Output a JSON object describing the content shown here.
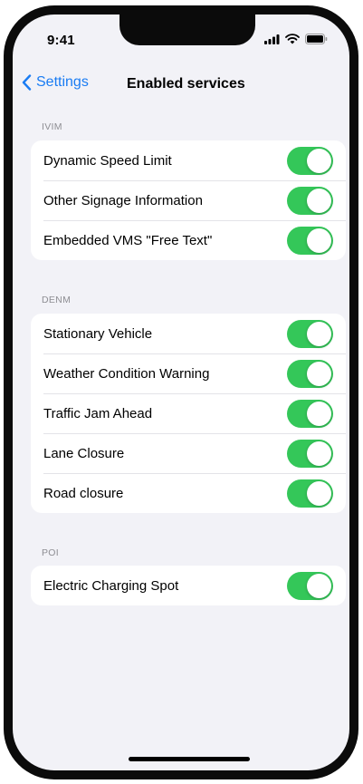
{
  "status_bar": {
    "time": "9:41"
  },
  "nav": {
    "back_label": "Settings",
    "title": "Enabled services"
  },
  "colors": {
    "accent": "#1a7cf3",
    "toggle_on": "#34c759",
    "background": "#f2f2f7"
  },
  "sections": [
    {
      "header": "IVIM",
      "items": [
        {
          "label": "Dynamic Speed Limit",
          "enabled": true
        },
        {
          "label": "Other Signage Information",
          "enabled": true
        },
        {
          "label": "Embedded VMS \"Free Text\"",
          "enabled": true
        }
      ]
    },
    {
      "header": "DENM",
      "items": [
        {
          "label": "Stationary Vehicle",
          "enabled": true
        },
        {
          "label": "Weather Condition Warning",
          "enabled": true
        },
        {
          "label": "Traffic Jam Ahead",
          "enabled": true
        },
        {
          "label": "Lane Closure",
          "enabled": true
        },
        {
          "label": "Road closure",
          "enabled": true
        }
      ]
    },
    {
      "header": "POI",
      "items": [
        {
          "label": "Electric Charging Spot",
          "enabled": true
        }
      ]
    }
  ]
}
